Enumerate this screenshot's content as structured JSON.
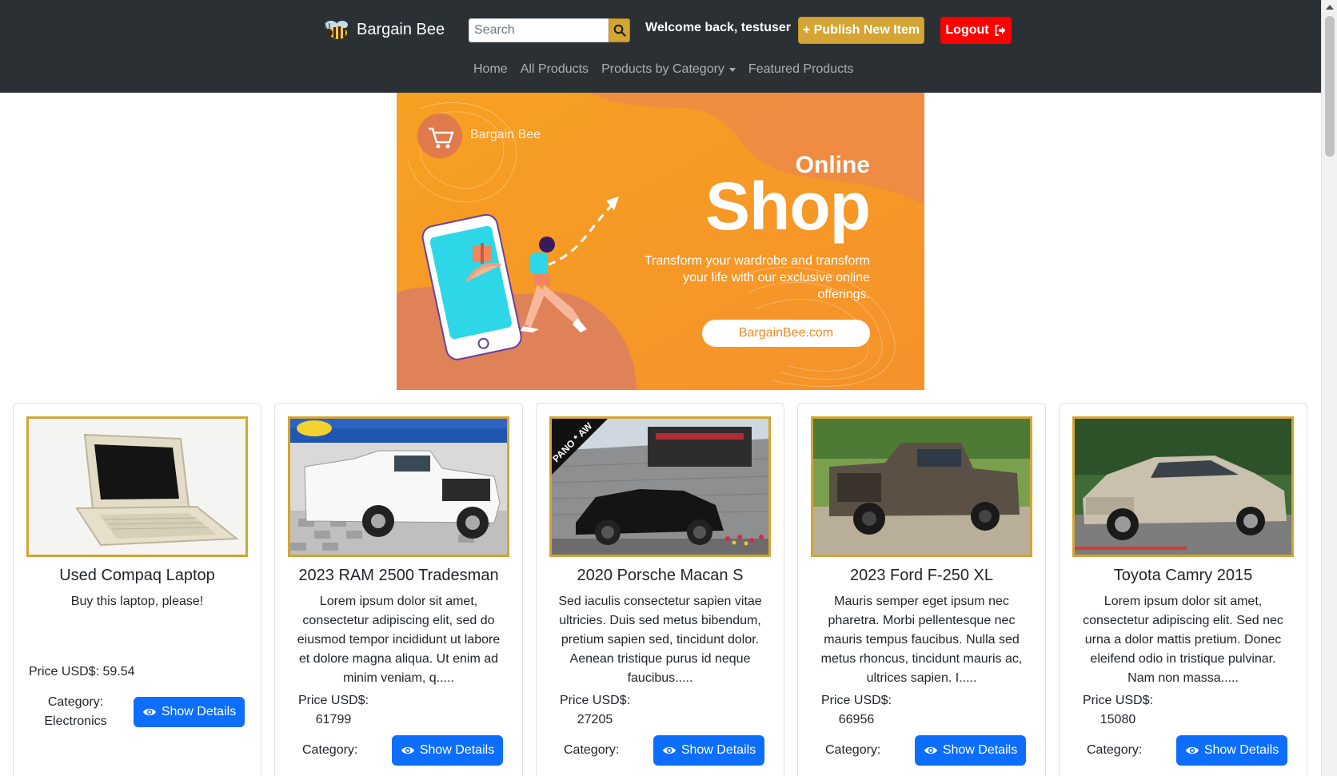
{
  "header": {
    "brand": "Bargain Bee",
    "search_placeholder": "Search",
    "welcome": "Welcome back, testuser",
    "publish_label": "+ Publish New Item",
    "logout_label": "Logout",
    "nav": [
      {
        "label": "Home"
      },
      {
        "label": "All Products"
      },
      {
        "label": "Products by Category"
      },
      {
        "label": "Featured Products"
      }
    ]
  },
  "banner": {
    "brand": "Bargain Bee",
    "online": "Online",
    "shop": "Shop",
    "tagline": "Transform your wardrobe and transform your life with our exclusive online offerings.",
    "url": "BargainBee.com"
  },
  "products": [
    {
      "title": "Used Compaq Laptop",
      "description": "Buy this laptop, please!",
      "price_label": "Price USD$: 59.54",
      "category_label": "Category:",
      "category": "Electronics",
      "button": "Show Details"
    },
    {
      "title": "2023 RAM 2500 Tradesman",
      "description": "Lorem ipsum dolor sit amet, consectetur adipiscing elit, sed do eiusmod tempor incididunt ut labore et dolore magna aliqua. Ut enim ad minim veniam, q.....",
      "price_label": "Price USD$:",
      "price": "61799",
      "category_label": "Category:",
      "button": "Show Details"
    },
    {
      "title": "2020 Porsche Macan S",
      "description": "Sed iaculis consectetur sapien vitae ultricies. Duis sed metus bibendum, pretium sapien sed, tincidunt dolor. Aenean tristique purus id neque faucibus.....",
      "price_label": "Price USD$:",
      "price": "27205",
      "category_label": "Category:",
      "button": "Show Details",
      "image_text": "PANO * AW"
    },
    {
      "title": "2023 Ford F-250 XL",
      "description": "Mauris semper eget ipsum nec pharetra. Morbi pellentesque nec mauris tempus faucibus. Nulla sed metus rhoncus, tincidunt mauris ac, ultrices sapien. I.....",
      "price_label": "Price USD$:",
      "price": "66956",
      "category_label": "Category:",
      "button": "Show Details"
    },
    {
      "title": "Toyota Camry 2015",
      "description": "Lorem ipsum dolor sit amet, consectetur adipiscing elit. Sed nec urna a dolor mattis pretium. Donec eleifend odio in tristique pulvinar. Nam non massa.....",
      "price_label": "Price USD$:",
      "price": "15080",
      "category_label": "Category:",
      "button": "Show Details"
    }
  ],
  "colors": {
    "navbar_bg": "#2b3035",
    "accent_gold": "#d4a534",
    "logout_red": "#ff0000",
    "primary_blue": "#0d6efd",
    "banner_orange": "#f79a22"
  },
  "icons": {
    "brand": "bee-logo-icon",
    "search": "search-icon",
    "logout": "logout-icon",
    "details": "eye-icon",
    "banner_cart": "shopping-cart-icon"
  }
}
